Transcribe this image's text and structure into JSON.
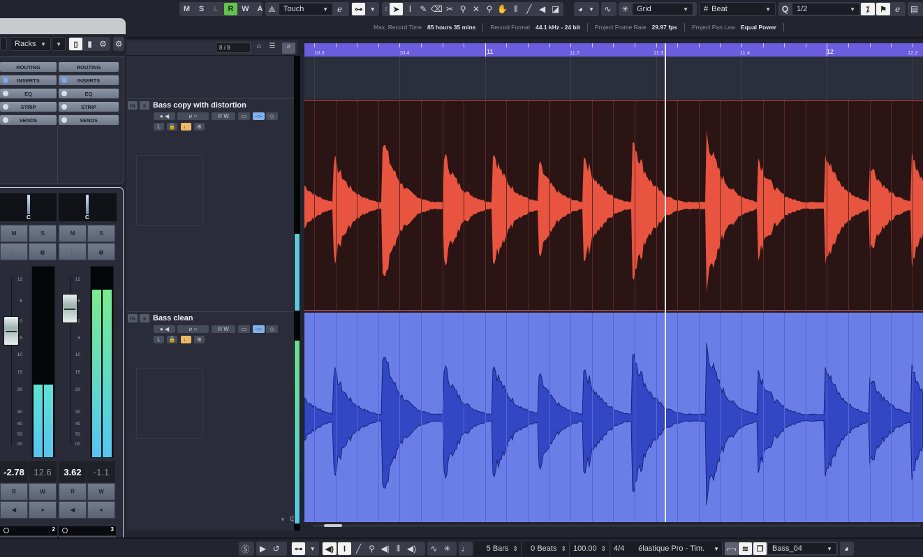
{
  "toolbar": {
    "state_buttons": [
      "M",
      "S",
      "L",
      "R",
      "W",
      "A"
    ],
    "automation_mode": "Touch",
    "snap_type": "Grid",
    "grid_type": "Beat",
    "quantize_label": "Q",
    "quantize_value": "1/2",
    "tool_icons": [
      "object-selection-icon",
      "range-selection-icon",
      "draw-icon",
      "erase-icon",
      "split-icon",
      "glue-icon",
      "mute-icon",
      "zoom-icon",
      "hand-icon",
      "comp-icon",
      "line-icon",
      "play-icon",
      "color-icon"
    ]
  },
  "info_line": {
    "items": [
      {
        "label": "Max. Record Time",
        "value": "85 hours 35 mins"
      },
      {
        "label": "Record Format",
        "value": "44.1 kHz - 24 bit"
      },
      {
        "label": "Project Frame Rate",
        "value": "29.97 fps"
      },
      {
        "label": "Project Pan Law",
        "value": "Equal Power"
      }
    ]
  },
  "left_panel": {
    "view_select": "Racks",
    "track_count": "8 / 8",
    "rack_buttons": [
      "ROUTING",
      "INSERTS",
      "EQ",
      "STRIP",
      "SENDS"
    ],
    "pan_label": "C"
  },
  "mixer": {
    "scale": [
      "12",
      "6",
      "0",
      "5",
      "10",
      "15",
      "20",
      "30",
      "40",
      "50",
      "00"
    ],
    "channels": [
      {
        "name": "Bass copy with distortion",
        "number": "2",
        "volume": "-2.78",
        "peak": "12.6",
        "meter_level": 0.38,
        "meter_color": "cyan"
      },
      {
        "name": "Bass clean",
        "number": "3",
        "volume": "3.62",
        "peak": "-1.1",
        "meter_level": 0.88,
        "meter_color": "green"
      }
    ],
    "buttons": {
      "mute": "M",
      "solo": "S",
      "listen": "L",
      "edit": "e",
      "read": "R",
      "write": "W"
    }
  },
  "tracks": [
    {
      "name": "Bass copy with distortion",
      "color": "#e8543f",
      "bg": "#2a1414"
    },
    {
      "name": "Bass clean",
      "color": "#2a3fb0",
      "bg": "#6b7ee8"
    }
  ],
  "ruler": {
    "labels": [
      "10.3",
      "10.4",
      "11",
      "11.2",
      "11.3",
      "11.4",
      "12",
      "12.2"
    ],
    "color": "#6c5ce0"
  },
  "bottom_toolbar": {
    "length_bars": "5 Bars",
    "length_beats": "0 Beats",
    "tempo": "100.00",
    "signature": "4/4",
    "algorithm": "élastique Pro - Tim.",
    "musical_mode_name": "Bass_04"
  }
}
